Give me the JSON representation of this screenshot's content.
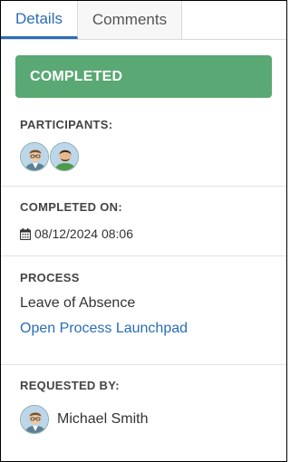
{
  "tabs": {
    "details": "Details",
    "comments": "Comments"
  },
  "status": {
    "label": "COMPLETED",
    "color": "#5aa873"
  },
  "participants": {
    "label": "PARTICIPANTS:",
    "avatars": [
      "man-glasses-avatar",
      "man-green-shirt-avatar"
    ]
  },
  "completed_on": {
    "label": "COMPLETED ON:",
    "value": "08/12/2024 08:06",
    "icon": "calendar-icon"
  },
  "process": {
    "label": "PROCESS",
    "name": "Leave of Absence",
    "link": "Open Process Launchpad"
  },
  "requested_by": {
    "label": "REQUESTED BY:",
    "name": "Michael Smith"
  },
  "colors": {
    "accent": "#2a6db6",
    "success": "#5aa873"
  }
}
